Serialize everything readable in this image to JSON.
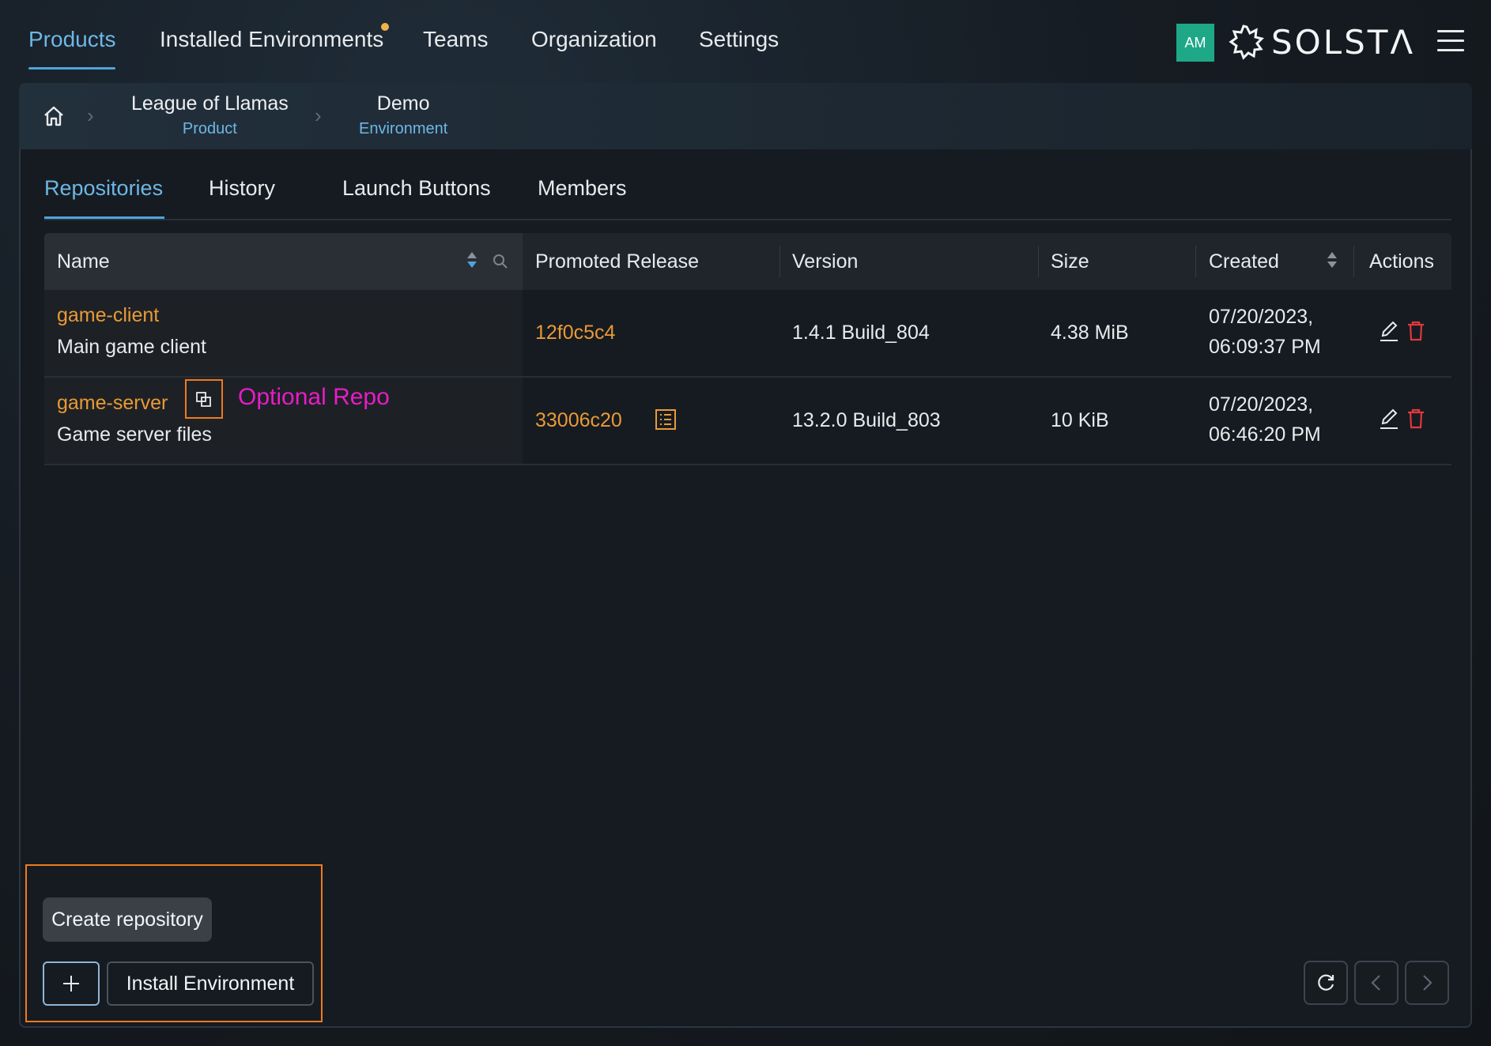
{
  "nav": {
    "items": [
      "Products",
      "Installed Environments",
      "Teams",
      "Organization",
      "Settings"
    ],
    "active": "Products",
    "avatar_initials": "AM",
    "logo_text": "SOLSTΛ",
    "accent_color": "#6db7e6",
    "notification_dot_color": "#f0b14b"
  },
  "breadcrumb": {
    "home_icon": "home-icon",
    "items": [
      {
        "title": "League of Llamas",
        "subtitle": "Product"
      },
      {
        "title": "Demo",
        "subtitle": "Environment"
      }
    ]
  },
  "tabs": {
    "items": [
      "Repositories",
      "History",
      "Launch Buttons",
      "Members"
    ],
    "active": "Repositories"
  },
  "table": {
    "columns": [
      "Name",
      "Promoted Release",
      "Version",
      "Size",
      "Created",
      "Actions"
    ],
    "rows": [
      {
        "name": "game-client",
        "description": "Main game client",
        "release": "12f0c5c4",
        "version": "1.4.1 Build_804",
        "size": "4.38 MiB",
        "created_date": "07/20/2023,",
        "created_time": "06:09:37 PM"
      },
      {
        "name": "game-server",
        "description": "Game server files",
        "release": "33006c20",
        "version": "13.2.0 Build_803",
        "size": "10 KiB",
        "created_date": "07/20/2023,",
        "created_time": "06:46:20 PM"
      }
    ],
    "action_icons": [
      "edit-icon",
      "trash-icon"
    ],
    "link_color": "#e99a35",
    "delete_color": "#e0383c"
  },
  "annotation": {
    "optional_label": "Optional Repo",
    "label_color": "#e81cc6",
    "box_color": "#f07a1e"
  },
  "footer": {
    "create_button": "Create repository",
    "install_button": "Install Environment",
    "add_icon": "plus-icon",
    "refresh_icon": "refresh-icon",
    "prev_icon": "chevron-left-icon",
    "next_icon": "chevron-right-icon"
  }
}
